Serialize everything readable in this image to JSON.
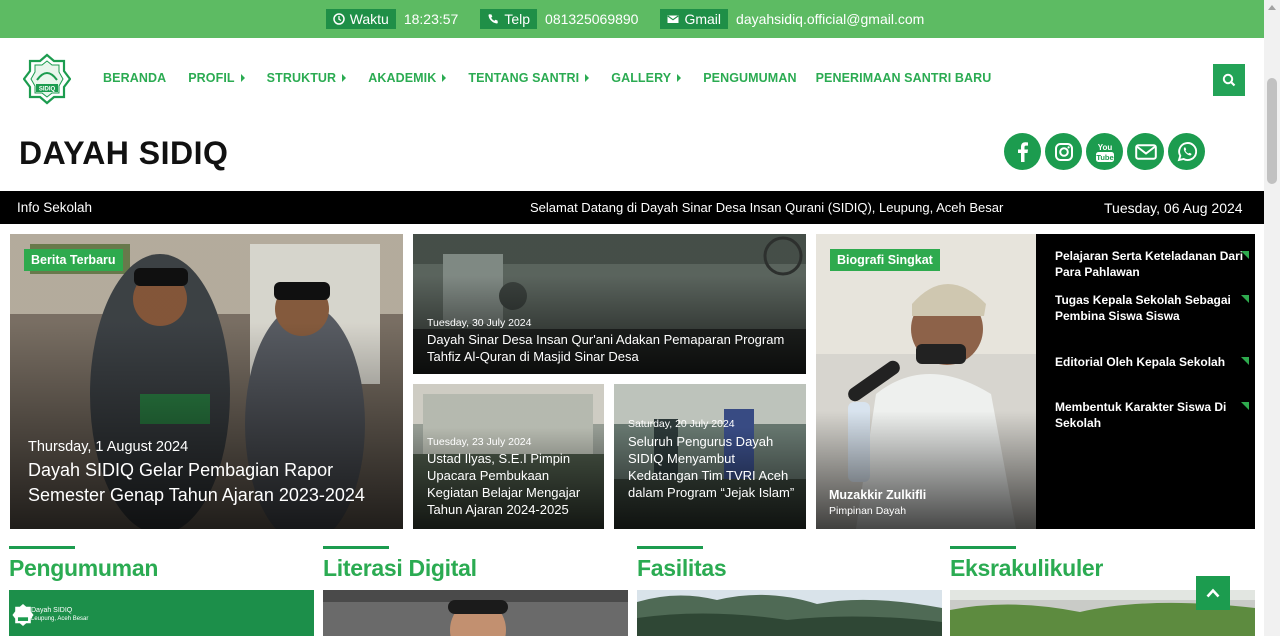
{
  "topbar": {
    "waktu_label": "Waktu",
    "waktu_value": "18:23:57",
    "telp_label": "Telp",
    "telp_value": "081325069890",
    "gmail_label": "Gmail",
    "gmail_value": "dayahsidiq.official@gmail.com"
  },
  "logo": {
    "text": "SIDIQ"
  },
  "menu": {
    "items": [
      {
        "label": "BERANDA"
      },
      {
        "label": "PROFIL"
      },
      {
        "label": "STRUKTUR"
      },
      {
        "label": "AKADEMIK"
      },
      {
        "label": "TENTANG SANTRI"
      },
      {
        "label": "GALLERY"
      },
      {
        "label": "PENGUMUMAN"
      },
      {
        "label": "PENERIMAAN SANTRI BARU"
      }
    ]
  },
  "site": {
    "title": "DAYAH SIDIQ"
  },
  "socials": [
    "facebook-icon",
    "instagram-icon",
    "youtube-icon",
    "email-icon",
    "whatsapp-icon"
  ],
  "youtube_text": "You Tube",
  "ticker": {
    "label": "Info Sekolah",
    "message": "Selamat Datang di Dayah Sinar Desa Insan Qurani (SIDIQ), Leupung, Aceh Besar",
    "date": "Tuesday, 06 Aug 2024"
  },
  "news": {
    "featured": {
      "badge": "Berita Terbaru",
      "date": "Thursday, 1 August 2024",
      "title": "Dayah SIDIQ Gelar Pembagian Rapor Semester Genap Tahun Ajaran 2023-2024"
    },
    "top": {
      "date": "Tuesday, 30 July 2024",
      "title": "Dayah Sinar Desa Insan Qur'ani Adakan Pemaparan Program Tahfiz Al-Quran di Masjid Sinar Desa"
    },
    "left": {
      "date": "Tuesday, 23 July 2024",
      "title": "Ustad Ilyas, S.E.I Pimpin Upacara Pembukaan Kegiatan Belajar Mengajar Tahun Ajaran 2024-2025"
    },
    "right": {
      "date": "Saturday, 20 July 2024",
      "title": "Seluruh Pengurus Dayah SIDIQ Menyambut Kedatangan Tim TVRI Aceh dalam Program “Jejak Islam”"
    }
  },
  "bio": {
    "badge": "Biografi Singkat",
    "name": "Muzakkir Zulkifli",
    "role": "Pimpinan Dayah",
    "items": [
      {
        "title": "Pelajaran Serta Keteladanan Dari Para Pahlawan"
      },
      {
        "title": "Tugas Kepala Sekolah Sebagai Pembina Siswa Siswa"
      },
      {
        "title": "Editorial Oleh Kepala Sekolah"
      },
      {
        "title": "Membentuk Karakter Siswa Di Sekolah"
      }
    ]
  },
  "sections": [
    {
      "title": "Pengumuman"
    },
    {
      "title": "Literasi Digital"
    },
    {
      "title": "Fasilitas"
    },
    {
      "title": "Eksrakulikuler"
    }
  ],
  "announcement_banner": {
    "line1": "Dayah SIDIQ",
    "line2": "Leupung, Aceh Besar"
  },
  "colors": {
    "topbar": "#5dbb63",
    "accent": "#1c9c4f",
    "menu_text": "#2bab52"
  }
}
